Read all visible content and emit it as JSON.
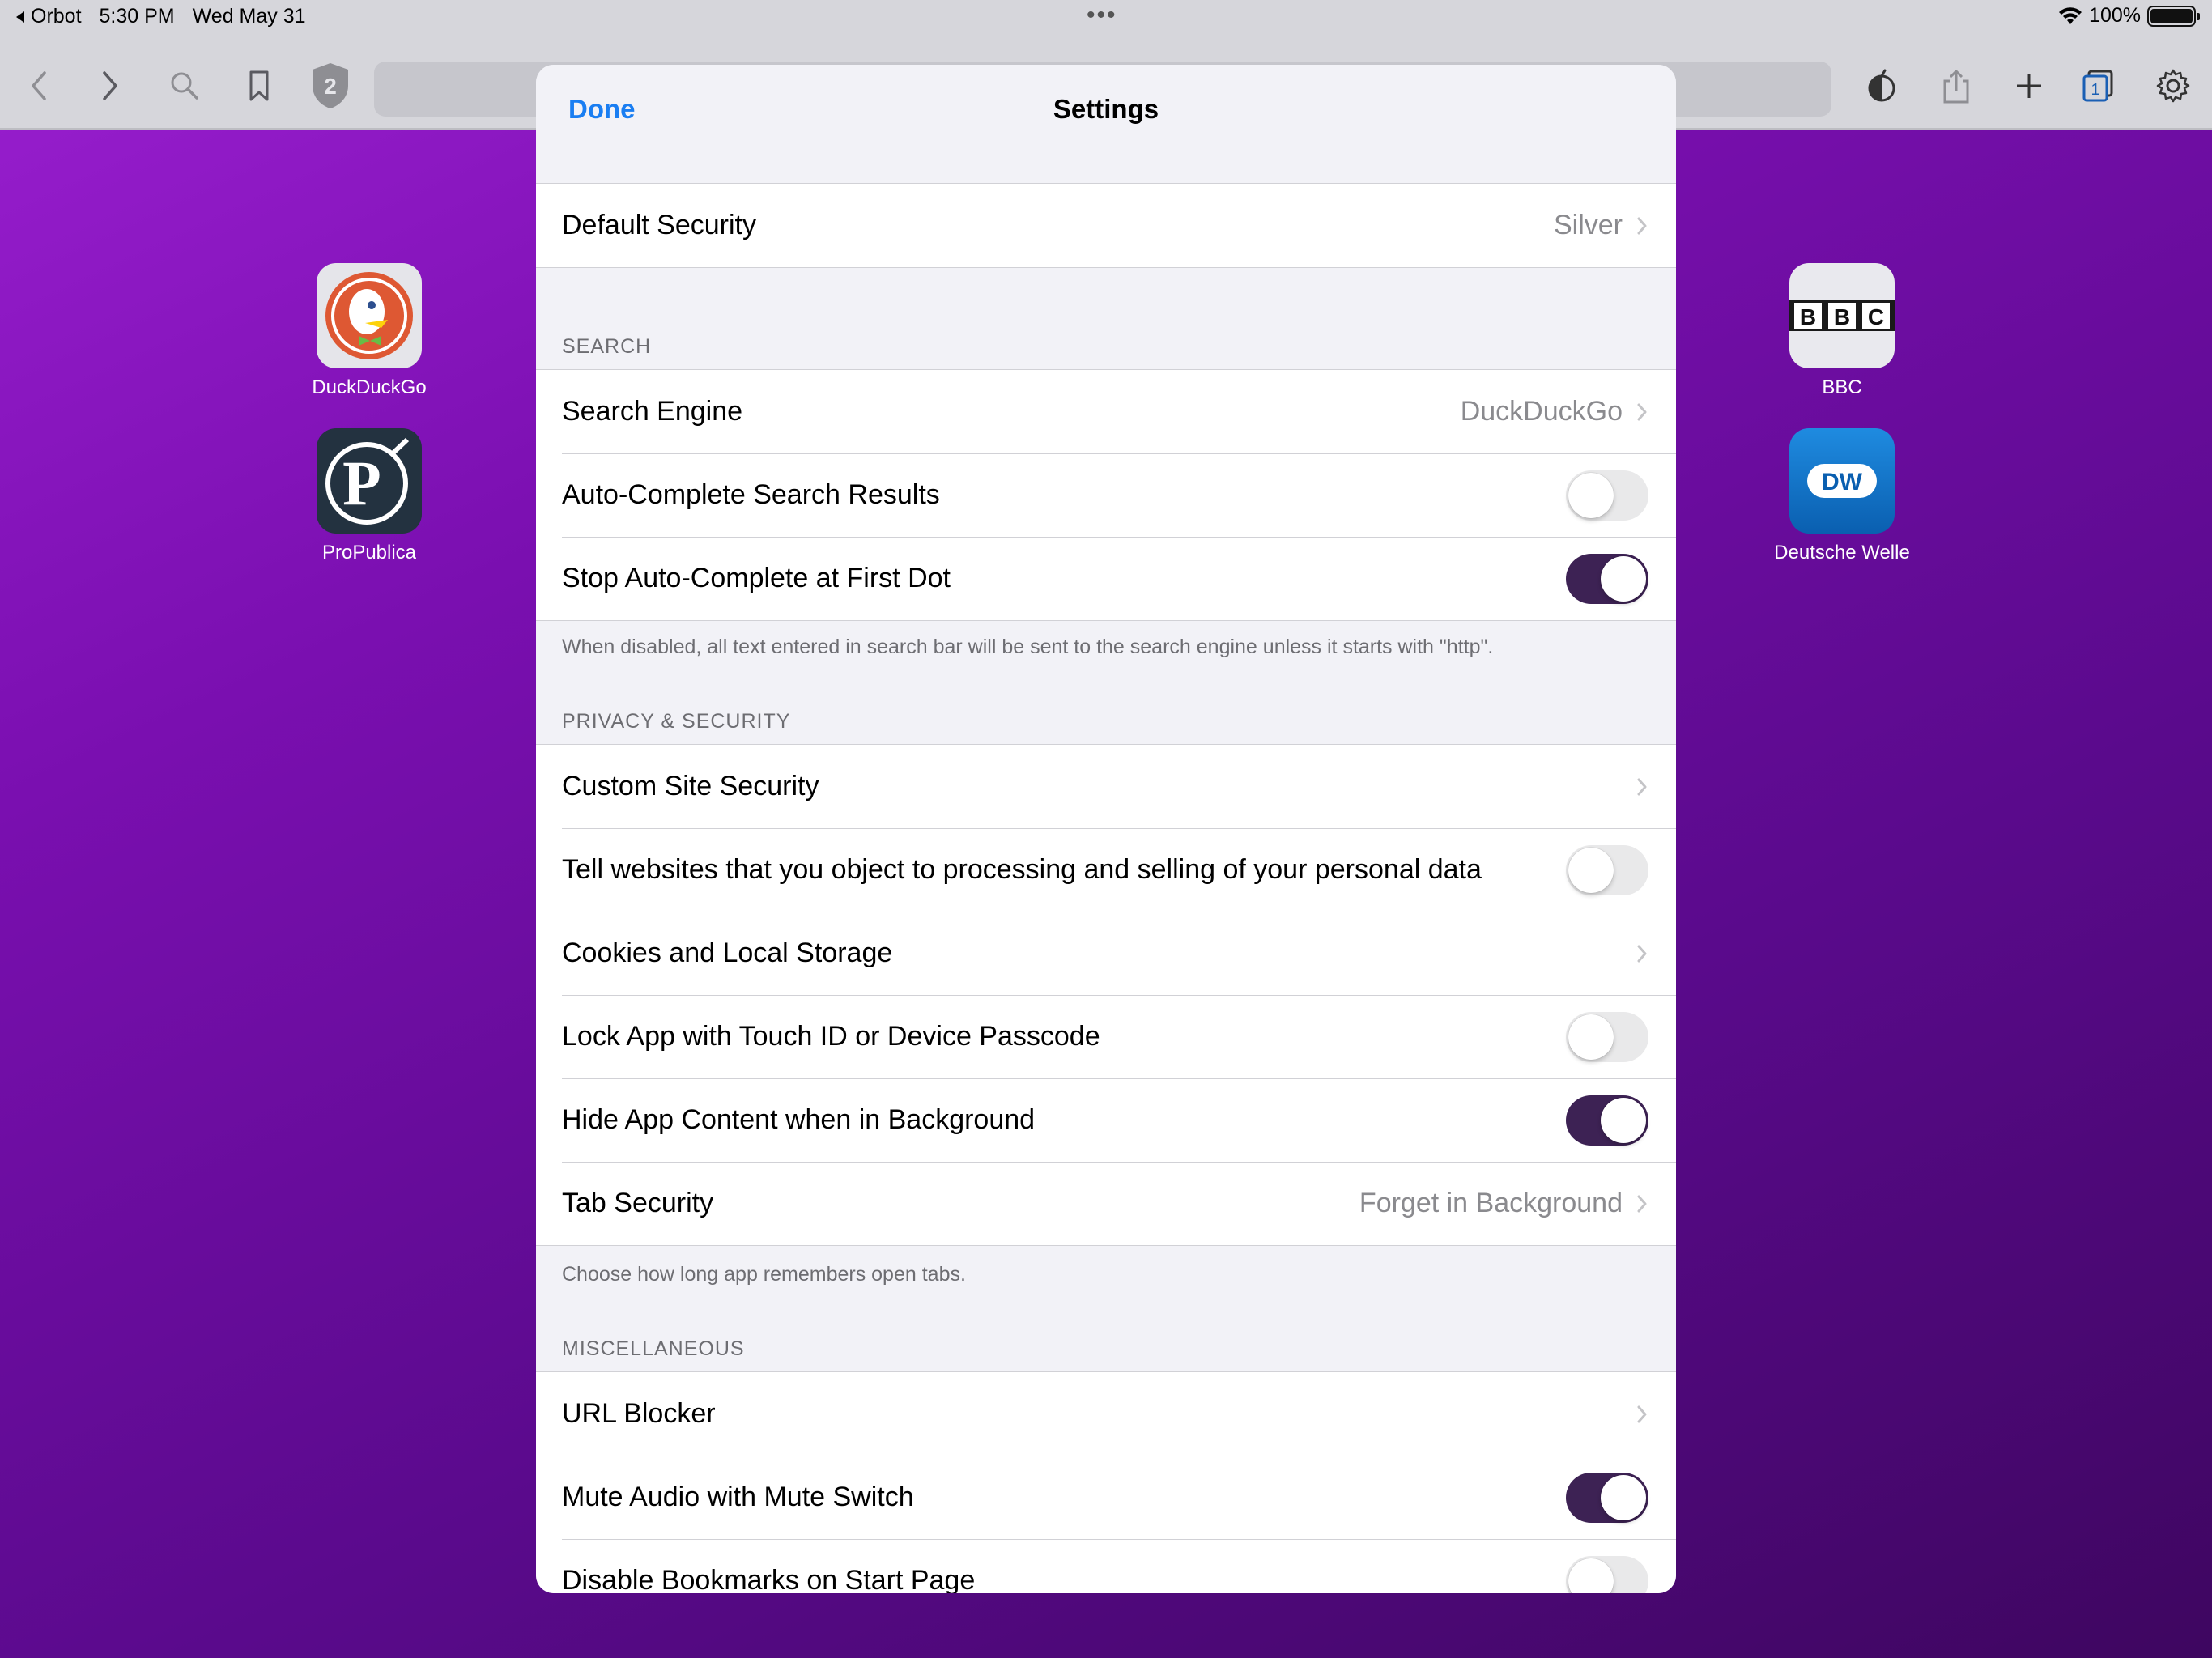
{
  "status_bar": {
    "back_app": "Orbot",
    "time": "5:30 PM",
    "date": "Wed May 31",
    "dots": "•••",
    "battery": "100%"
  },
  "toolbar": {
    "shield_count": "2",
    "tabs_count": "1"
  },
  "home_tiles": [
    {
      "label": "DuckDuckGo"
    },
    {
      "label": "ProPublica"
    },
    {
      "label": "BBC"
    },
    {
      "label": "Deutsche Welle"
    }
  ],
  "tile_text": {
    "bbc_letters": [
      "B",
      "B",
      "C"
    ],
    "propublica_letter": "P",
    "dw_letters": "DW"
  },
  "settings": {
    "done_label": "Done",
    "title": "Settings",
    "default_security": {
      "label": "Default Security",
      "value": "Silver"
    },
    "search": {
      "header": "SEARCH",
      "search_engine": {
        "label": "Search Engine",
        "value": "DuckDuckGo"
      },
      "auto_complete": {
        "label": "Auto-Complete Search Results",
        "on": false
      },
      "stop_auto_complete": {
        "label": "Stop Auto-Complete at First Dot",
        "on": true
      },
      "footer": "When disabled, all text entered in search bar will be sent to the search engine unless it starts with \"http\"."
    },
    "privacy": {
      "header": "PRIVACY & SECURITY",
      "custom_site_security": {
        "label": "Custom Site Security"
      },
      "object_processing": {
        "label": "Tell websites that you object to processing and selling of your personal data",
        "on": false
      },
      "cookies": {
        "label": "Cookies and Local Storage"
      },
      "lock_app": {
        "label": "Lock App with Touch ID or Device Passcode",
        "on": false
      },
      "hide_content": {
        "label": "Hide App Content when in Background",
        "on": true
      },
      "tab_security": {
        "label": "Tab Security",
        "value": "Forget in Background"
      },
      "footer": "Choose how long app remembers open tabs."
    },
    "misc": {
      "header": "MISCELLANEOUS",
      "url_blocker": {
        "label": "URL Blocker"
      },
      "mute_audio": {
        "label": "Mute Audio with Mute Switch",
        "on": true
      },
      "disable_bookmarks": {
        "label": "Disable Bookmarks on Start Page",
        "on": false
      }
    }
  },
  "colors": {
    "accent": "#1a7ef2",
    "toggle_on": "#3d2254",
    "background_gradient_start": "#9a1fd0",
    "background_gradient_end": "#3e0660"
  }
}
